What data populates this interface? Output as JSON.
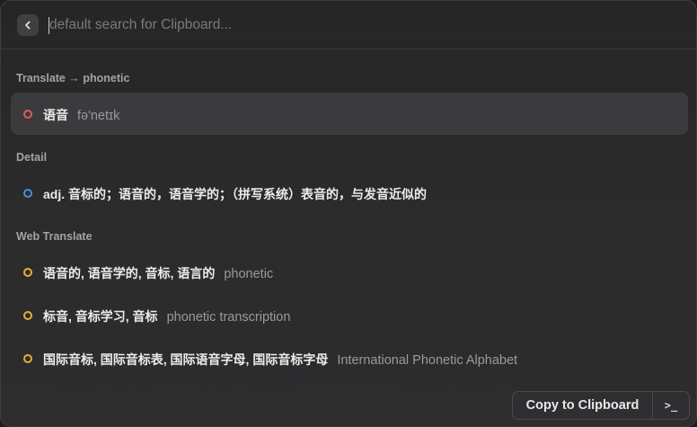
{
  "search": {
    "placeholder": "default search for Clipboard..."
  },
  "sections": {
    "translate": {
      "title": "Translate → phonetic"
    },
    "detail": {
      "title": "Detail"
    },
    "web": {
      "title": "Web Translate"
    }
  },
  "items": [
    {
      "title": "语音",
      "subtitle": "fə'netɪk",
      "dot_color": "#e05a5f"
    },
    {
      "title": "adj. 音标的；语音的，语音学的；（拼写系统）表音的，与发音近似的",
      "subtitle": "",
      "dot_color": "#4a90d9"
    },
    {
      "title": "语音的, 语音学的, 音标, 语言的",
      "subtitle": "phonetic",
      "dot_color": "#e6b030"
    },
    {
      "title": "标音, 音标学习, 音标",
      "subtitle": "phonetic transcription",
      "dot_color": "#e6b030"
    },
    {
      "title": "国际音标, 国际音标表, 国际语音字母, 国际音标字母",
      "subtitle": "International Phonetic Alphabet",
      "dot_color": "#e6b030"
    }
  ],
  "footer": {
    "copy_label": "Copy to Clipboard",
    "terminal_icon": ">_"
  },
  "icons": {
    "back": "chevron-left-icon",
    "item": "circle-icon",
    "terminal": "terminal-icon"
  }
}
